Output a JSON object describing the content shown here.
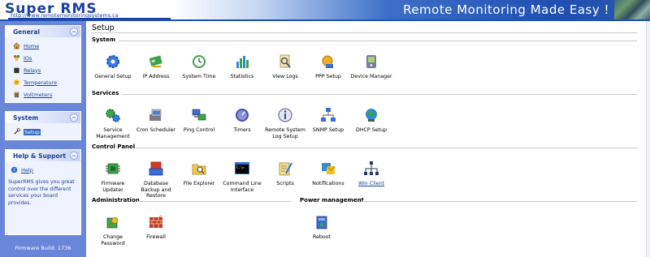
{
  "header": {
    "logo_title": "Super RMS",
    "logo_url": "http://www.remotemonitoringsystems.ca",
    "banner_text": "Remote Monitoring Made Easy !"
  },
  "sidebar": {
    "general": {
      "title": "General",
      "items": [
        {
          "label": "Home",
          "icon": "home-icon"
        },
        {
          "label": "IOs",
          "icon": "io-icon"
        },
        {
          "label": "Relays",
          "icon": "relay-icon"
        },
        {
          "label": "Temperature",
          "icon": "temperature-icon"
        },
        {
          "label": "Voltmeters",
          "icon": "voltmeter-icon"
        }
      ]
    },
    "system": {
      "title": "System",
      "items": [
        {
          "label": "Setup",
          "icon": "setup-icon",
          "active": true
        }
      ]
    },
    "help": {
      "title": "Help & Support",
      "link_label": "Help",
      "description": "SuperRMS gives you great control over the different services your board provides."
    },
    "firmware_build": "Firmware Build: 1736"
  },
  "main": {
    "page_title": "Setup",
    "sections": {
      "system": {
        "title": "System",
        "tiles": [
          "General Setup",
          "IP Address",
          "System Time",
          "Statistics",
          "View Logs",
          "PPP Setup",
          "Device Manager"
        ]
      },
      "services": {
        "title": "Services",
        "tiles": [
          "Service Management",
          "Cron Scheduler",
          "Ping Control",
          "Timers",
          "Remote System Log Setup",
          "SNMP Setup",
          "DHCP Setup"
        ]
      },
      "control_panel": {
        "title": "Control Panel",
        "tiles": [
          "Firmware Updater",
          "Database Backup and Restore",
          "File Explorer",
          "Command Line Interface",
          "Scripts",
          "Notifications",
          "Win Client"
        ]
      },
      "administration": {
        "title": "Administration",
        "tiles": [
          "Change Password",
          "Firewall"
        ]
      },
      "power_management": {
        "title": "Power management",
        "tiles": [
          "Reboot"
        ]
      }
    }
  },
  "colors": {
    "sidebar_bg": "#6a86d8",
    "panel_bg": "#eff3ff",
    "link": "#1c3f94",
    "banner_blue": "#1f4fb2"
  }
}
